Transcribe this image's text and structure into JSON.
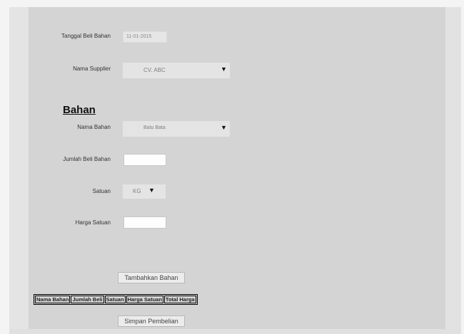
{
  "form": {
    "tanggal_label": "Tanggal Beli Bahan",
    "tanggal_value": "11-01-2015",
    "supplier_label": "Nama Supplier",
    "supplier_value": "CV. ABC",
    "section_heading": "Bahan",
    "bahan_label": "Nama Bahan",
    "bahan_value": "Batu Bata",
    "jumlah_label": "Jumlah Beli Bahan",
    "jumlah_value": "",
    "satuan_label": "Satuan",
    "satuan_value": "KG",
    "harga_label": "Harga Satuan",
    "harga_value": "",
    "add_button_label": "Tambahkan Bahan",
    "save_button_label": "Simpan Pembelian"
  },
  "table": {
    "columns": [
      "Nama Bahan",
      "Jumlah Beli",
      "Satuan",
      "Harga Satuan",
      "Total Harga"
    ]
  },
  "icons": {
    "dropdown": "triangle-down-icon"
  }
}
